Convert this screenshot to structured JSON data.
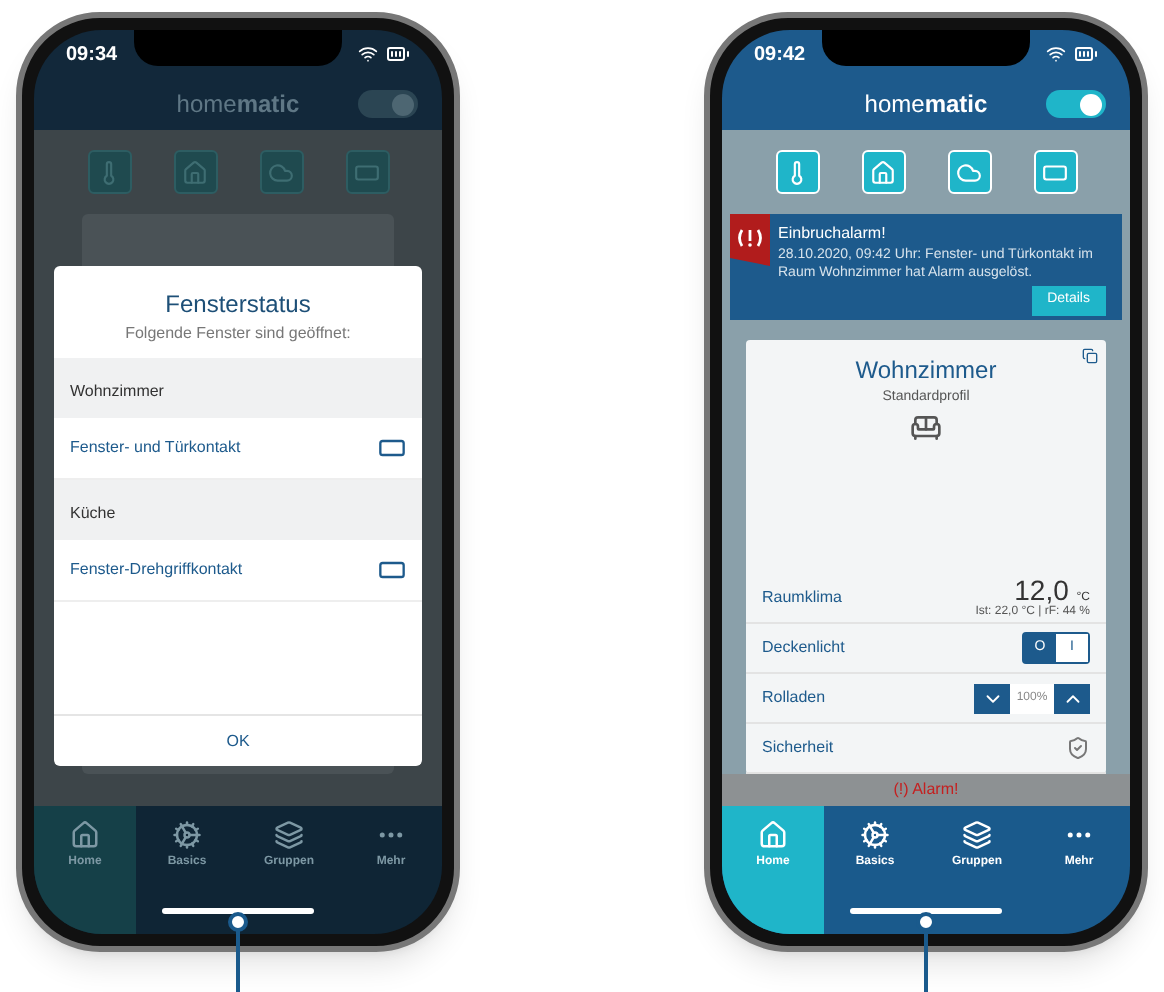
{
  "left_phone": {
    "status_time": "09:34",
    "brand": "home**matic**",
    "dialog": {
      "title": "Fensterstatus",
      "subtitle": "Folgende Fenster sind geöffnet:",
      "sections": [
        {
          "room": "Wohnzimmer",
          "items": [
            "Fenster- und Türkontakt"
          ]
        },
        {
          "room": "Küche",
          "items": [
            "Fenster-Drehgriffkontakt"
          ]
        }
      ],
      "button": "OK"
    },
    "tabs": [
      {
        "label": "Home",
        "selected": true
      },
      {
        "label": "Basics",
        "selected": false
      },
      {
        "label": "Gruppen",
        "selected": false
      },
      {
        "label": "Mehr",
        "selected": false
      }
    ]
  },
  "right_phone": {
    "status_time": "09:42",
    "brand": "home**matic**",
    "alarm_banner": {
      "title": "Einbruchalarm!",
      "message": "28.10.2020, 09:42 Uhr: Fenster- und Türkontakt im Raum Wohnzimmer hat Alarm ausgelöst.",
      "link": "Details"
    },
    "room_card": {
      "name": "Wohnzimmer",
      "profile": "Standardprofil",
      "rows": [
        {
          "kind": "climate",
          "label": "Raumklima",
          "value": "12,0",
          "unit": "°C",
          "detail": "Ist: 22,0 °C | rF: 44 %"
        },
        {
          "kind": "switch",
          "label": "Deckenlicht",
          "options": [
            {
              "label": "O",
              "selected": true
            },
            {
              "label": "I",
              "selected": false
            }
          ]
        },
        {
          "kind": "shutter",
          "label": "Rolladen",
          "value": "100%"
        },
        {
          "kind": "security",
          "label": "Sicherheit"
        }
      ]
    },
    "alarm_bar": "(!) Alarm!",
    "tabs": [
      {
        "label": "Home",
        "selected": true
      },
      {
        "label": "Basics",
        "selected": false
      },
      {
        "label": "Gruppen",
        "selected": false
      },
      {
        "label": "Mehr",
        "selected": false
      }
    ]
  }
}
